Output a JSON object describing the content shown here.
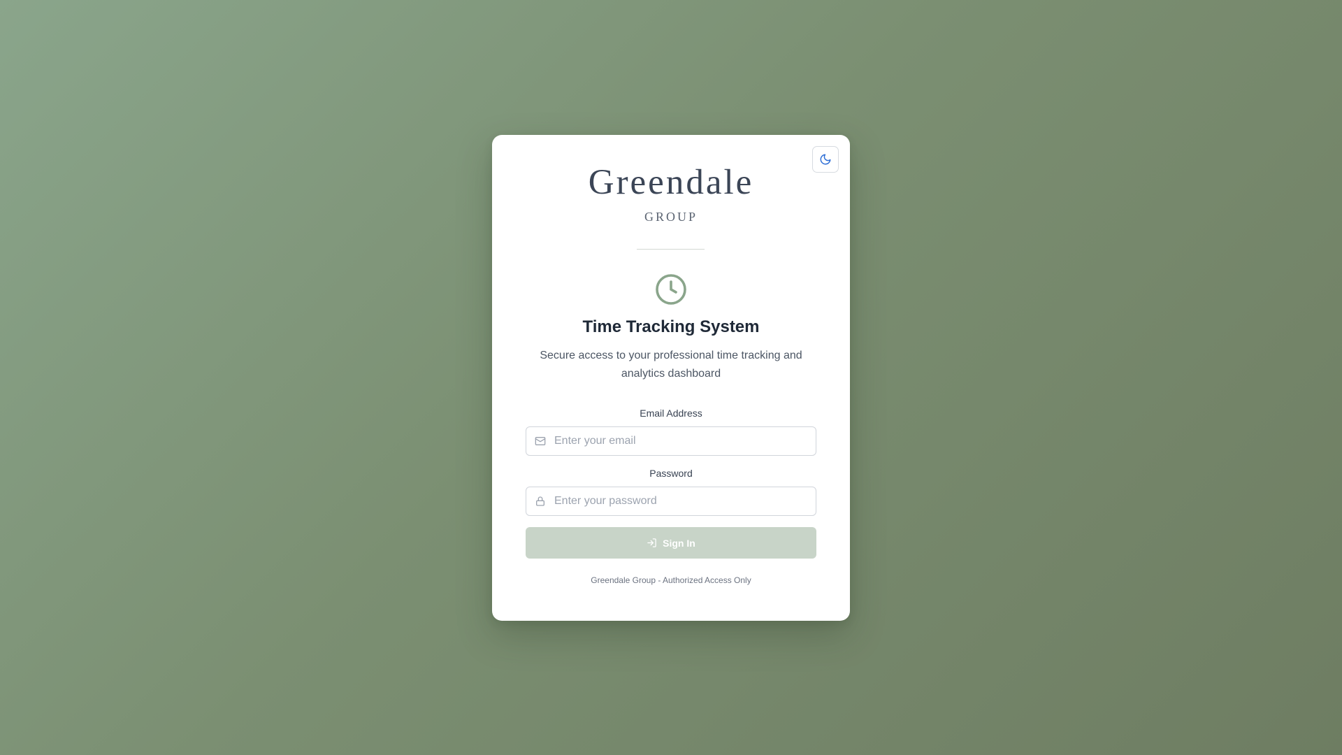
{
  "brand": {
    "name": "Greendale",
    "sub": "GROUP"
  },
  "hero": {
    "title": "Time Tracking System",
    "subtitle": "Secure access to your professional time tracking and analytics dashboard"
  },
  "form": {
    "email": {
      "label": "Email Address",
      "placeholder": "Enter your email",
      "value": ""
    },
    "password": {
      "label": "Password",
      "placeholder": "Enter your password",
      "value": ""
    },
    "submit_label": "Sign In"
  },
  "footer": {
    "text": "Greendale Group - Authorized Access Only"
  },
  "icons": {
    "theme_toggle": "moon-icon",
    "hero": "clock-icon",
    "email": "mail-icon",
    "password": "lock-icon",
    "submit": "log-in-icon"
  },
  "colors": {
    "accent": "#8aa58b",
    "button_bg": "#c8d4c8",
    "toggle_icon": "#2f6fd6",
    "title": "#1f2937"
  }
}
